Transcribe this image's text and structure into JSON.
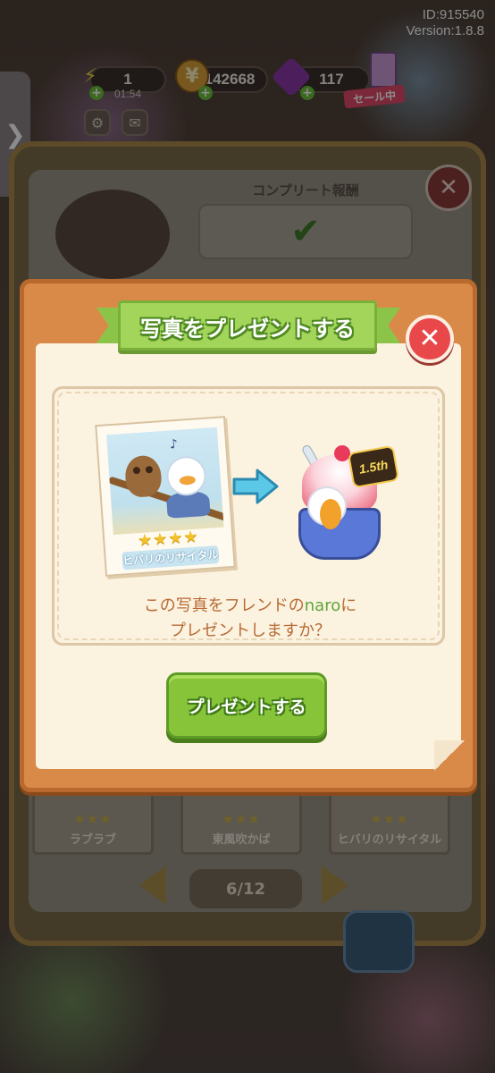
{
  "hud": {
    "id": "ID:915540",
    "version": "Version:1.8.8",
    "energy": "1",
    "timer": "01:54",
    "coins": "142668",
    "gems": "117",
    "sale": "セール中"
  },
  "album": {
    "complete_label": "コンプリート報酬",
    "complete_mark": "✔",
    "cards": [
      {
        "title": "ラブラブ",
        "stars": "★★★"
      },
      {
        "title": "東風吹かば",
        "stars": "★★★"
      },
      {
        "title": "ヒバリのリサイタル",
        "stars": "★★★"
      }
    ],
    "page": "6/12"
  },
  "modal": {
    "title": "写真をプレゼントする",
    "close": "✕",
    "photo_title": "ヒバリのリサイタル",
    "photo_stars": "★★★★",
    "photo_note": "♪",
    "badge": "1.5th",
    "question_before": "この写真をフレンドの",
    "friend_name": "naro",
    "question_after": "に",
    "question_line2": "プレゼントしますか？",
    "present_button": "プレゼントする"
  },
  "colors": {
    "modal_orange": "#d98a48",
    "ribbon_green": "#a3d55a",
    "button_green": "#88c43a",
    "close_red": "#e8484a",
    "text_brown": "#b86a34",
    "friend_green": "#5ea63a"
  },
  "icons": [
    "energy-icon",
    "coin-icon",
    "gem-icon",
    "gear-icon",
    "mail-icon",
    "close-icon",
    "arrow-right-icon",
    "chevron-right-icon"
  ]
}
